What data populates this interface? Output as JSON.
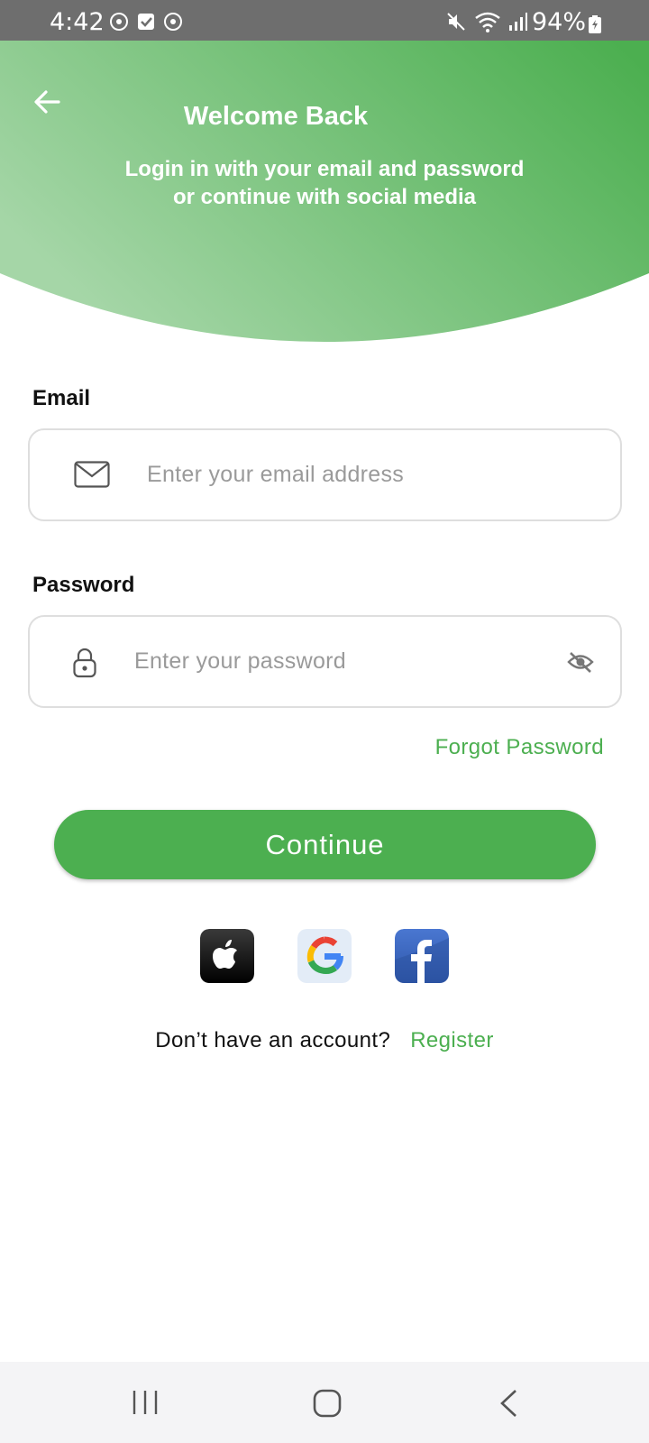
{
  "status_bar": {
    "time": "4:42",
    "battery": "94%"
  },
  "header": {
    "title": "Welcome Back",
    "subtitle_line1": "Login in with your email and password",
    "subtitle_line2": "or continue with social media",
    "gradient_start": "#a5d6a7",
    "gradient_end": "#4caf50"
  },
  "form": {
    "email_label": "Email",
    "email_placeholder": "Enter your email address",
    "email_value": "",
    "password_label": "Password",
    "password_placeholder": "Enter your password",
    "password_value": "",
    "forgot_password": "Forgot Password",
    "continue_label": "Continue"
  },
  "social": {
    "providers": [
      "apple-icon",
      "google-icon",
      "facebook-icon"
    ]
  },
  "register": {
    "question": "Don’t have an account?",
    "link": "Register"
  },
  "colors": {
    "accent": "#4caf50"
  }
}
